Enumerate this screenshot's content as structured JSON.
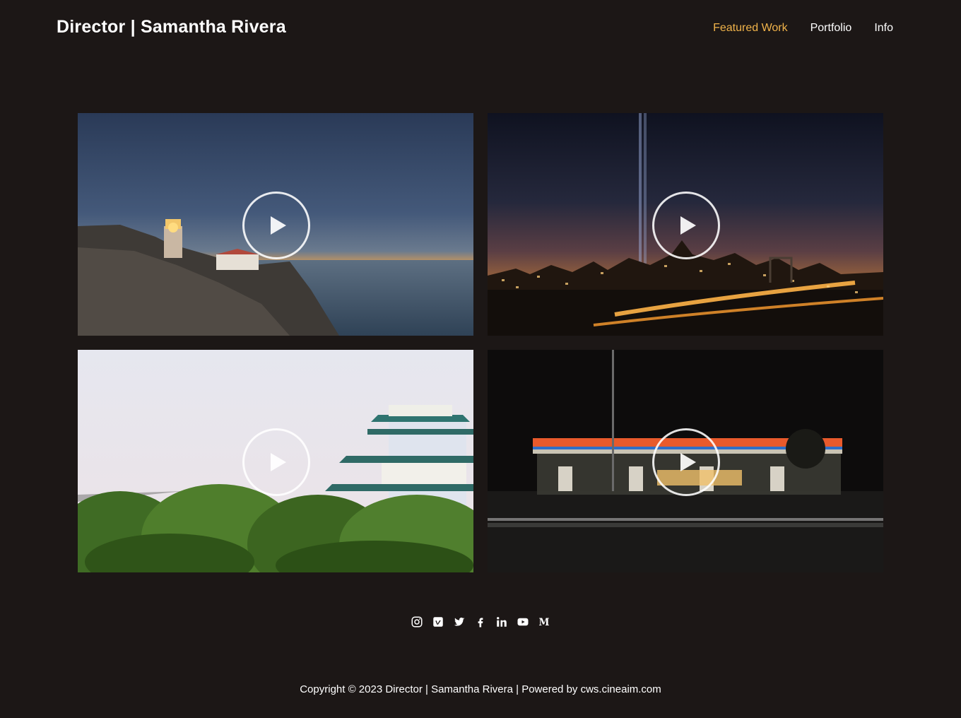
{
  "header": {
    "title": "Director | Samantha Rivera"
  },
  "nav": {
    "items": [
      "Featured Work",
      "Portfolio",
      "Info"
    ],
    "active_color": "#f0b34a"
  },
  "videos": [
    {
      "scene": "lighthouse-cliff-sunset"
    },
    {
      "scene": "city-skyline-night-lights"
    },
    {
      "scene": "japanese-castle-trees"
    },
    {
      "scene": "gas-station-night"
    }
  ],
  "social": {
    "icons": [
      "instagram-icon",
      "vimeo-icon",
      "twitter-icon",
      "facebook-icon",
      "linkedin-icon",
      "youtube-icon",
      "medium-icon"
    ],
    "medium_glyph": "M"
  },
  "footer": {
    "copyright": "Copyright © 2023 Director | Samantha Rivera | Powered by cws.cineaim.com"
  },
  "colors": {
    "background": "#1c1716",
    "accent": "#f0b34a",
    "text": "#ffffff"
  }
}
